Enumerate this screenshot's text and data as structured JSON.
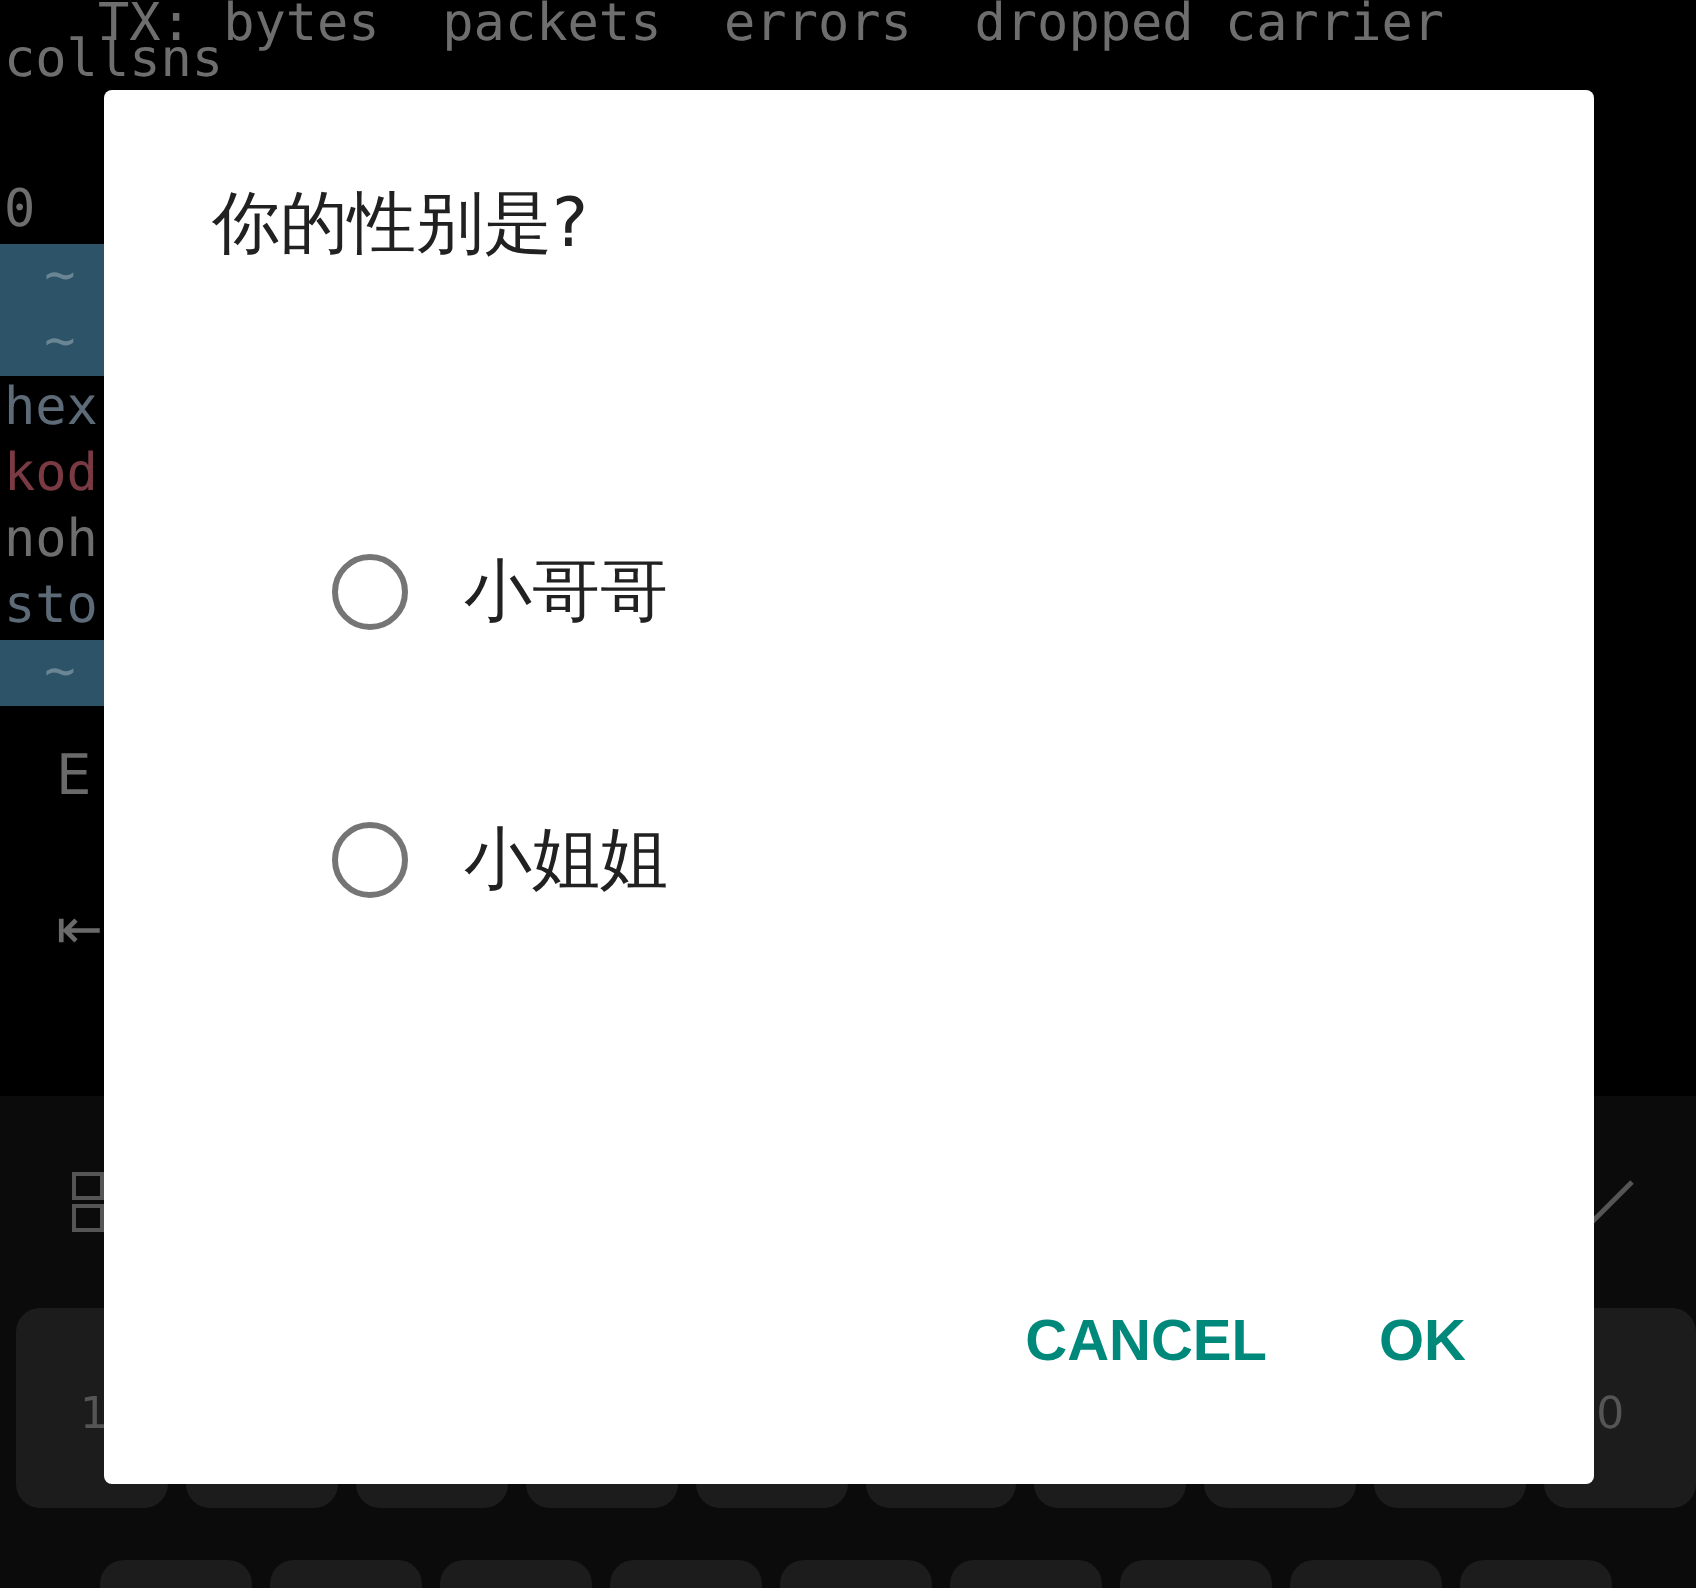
{
  "terminal": {
    "lines": [
      {
        "kind": "text",
        "text": "   TX: bytes  packets  errors  dropped carrier",
        "color": "#6e6e6e"
      },
      {
        "kind": "text",
        "text": "collsns",
        "color": "#6e6e6e"
      },
      {
        "kind": "blank"
      },
      {
        "kind": "text",
        "text": "0",
        "color": "#6e6e6e"
      },
      {
        "kind": "tilde",
        "text": "~"
      },
      {
        "kind": "tilde",
        "text": "~"
      },
      {
        "kind": "text",
        "text": "hex",
        "color": "#5d6b78"
      },
      {
        "kind": "text",
        "text": "kod",
        "color": "#7a3a44"
      },
      {
        "kind": "text",
        "text": "noh",
        "color": "#6e6e6e"
      },
      {
        "kind": "text",
        "text": "sto",
        "color": "#5d6b78"
      },
      {
        "kind": "tilde",
        "text": "~"
      }
    ],
    "extra_keys": [
      {
        "label": "E"
      },
      {
        "label": "⇤"
      }
    ]
  },
  "keyboard": {
    "keys": [
      {
        "hint": "1"
      },
      {
        "hint": "0"
      }
    ]
  },
  "dialog": {
    "title": "你的性别是?",
    "options": [
      {
        "label": "小哥哥",
        "selected": false
      },
      {
        "label": "小姐姐",
        "selected": false
      }
    ],
    "buttons": [
      {
        "label": "CANCEL"
      },
      {
        "label": "OK"
      }
    ]
  }
}
